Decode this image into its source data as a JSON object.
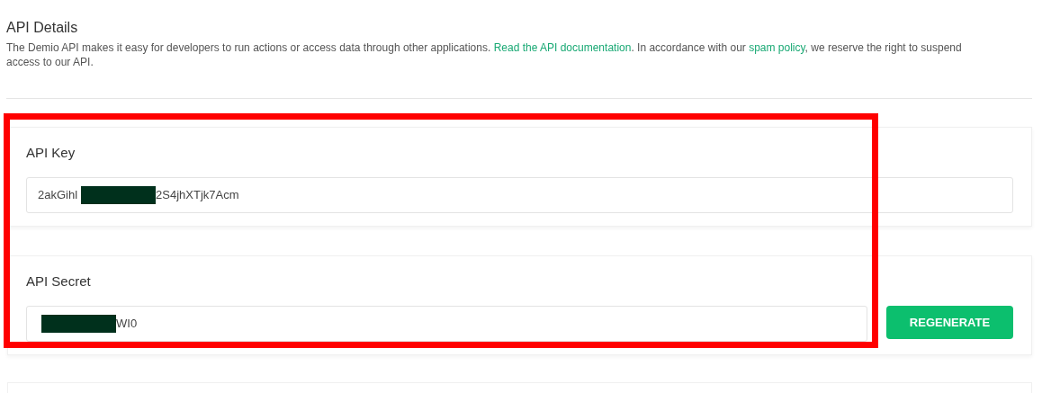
{
  "section": {
    "title": "API Details",
    "description": "The Demio API makes it easy for developers to run actions or access data through other applications. ",
    "doc_link": "Read the API documentation",
    "middle_text": ". In accordance with our ",
    "policy_link": "spam policy",
    "end_text": ", we reserve the right to suspend access to our API."
  },
  "fields": [
    {
      "label": "API Key",
      "value_start": "2akGihl",
      "redacted": true,
      "value_end": "2S4jhXTjk7Acm"
    },
    {
      "label": "API Secret",
      "redacted": true,
      "value_end": "WI0",
      "button": "REGENERATE"
    }
  ],
  "highlight": true
}
